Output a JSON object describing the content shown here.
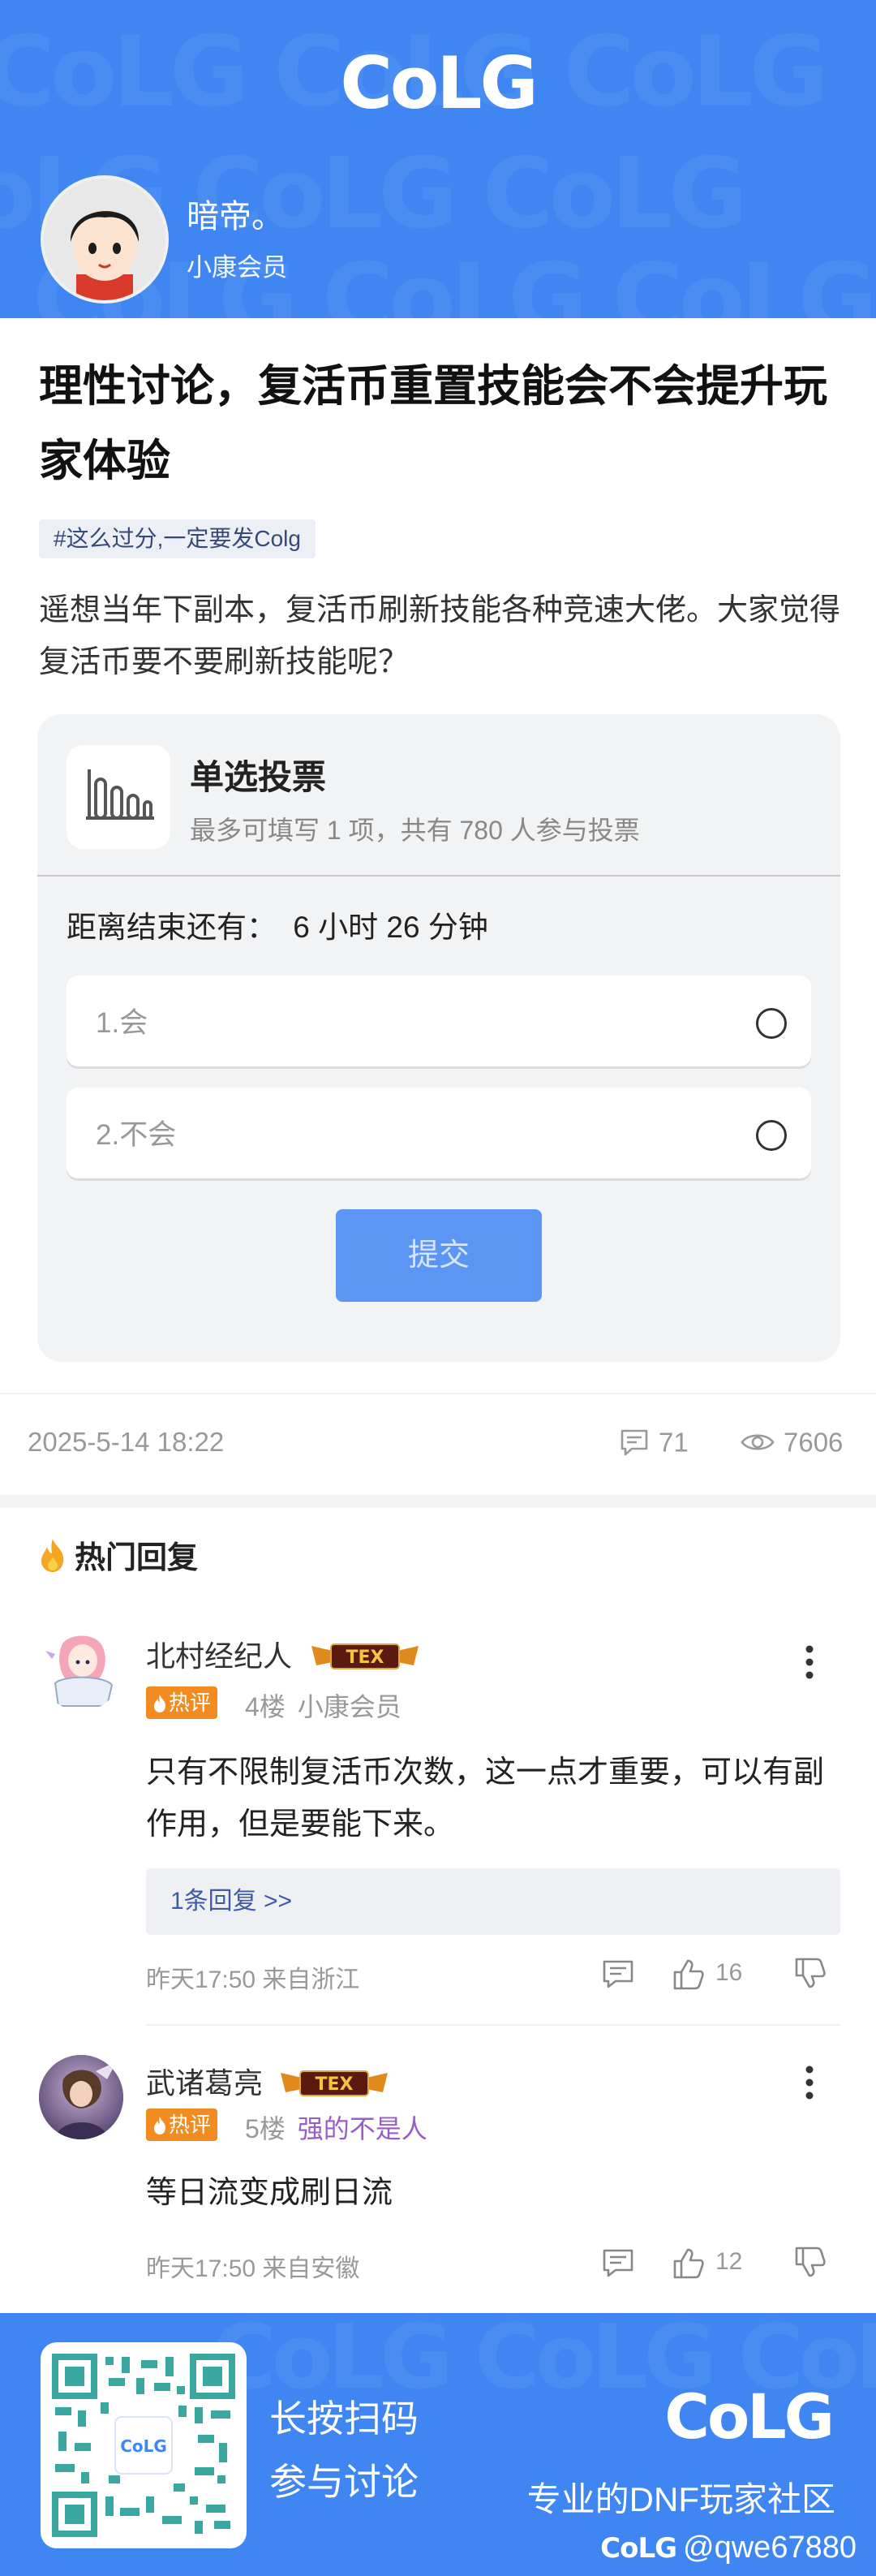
{
  "header": {
    "logo_text": "CoLG",
    "author_name": "暗帝。",
    "author_level": "小康会员"
  },
  "post": {
    "title": "理性讨论，复活币重置技能会不会提升玩家体验",
    "tag": "#这么过分,一定要发Colg",
    "body": "遥想当年下副本，复活币刷新技能各种竞速大佬。大家觉得复活币要不要刷新技能呢？"
  },
  "poll": {
    "title": "单选投票",
    "subtitle": "最多可填写 1 项，共有 780 人参与投票",
    "timer_label": "距离结束还有：",
    "timer_value": "6 小时 26 分钟",
    "options": [
      {
        "label": "1.会"
      },
      {
        "label": "2.不会"
      }
    ],
    "submit_label": "提交"
  },
  "meta": {
    "date": "2025-5-14 18:22",
    "comment_count": "71",
    "view_count": "7606"
  },
  "hot_section": {
    "title": "热门回复"
  },
  "replies": [
    {
      "name": "北村经纪人",
      "badge_text": "TEX",
      "hot_label": "热评",
      "floor": "4楼",
      "level": "小康会员",
      "content": "只有不限制复活币次数，这一点才重要，可以有副作用，但是要能下来。",
      "sub_reply": "1条回复 >>",
      "time": "昨天17:50 来自浙江",
      "likes": "16"
    },
    {
      "name": "武诸葛亮",
      "badge_text": "TEX",
      "hot_label": "热评",
      "floor": "5楼",
      "level": "强的不是人",
      "content": "等日流变成刷日流",
      "time": "昨天17:50 来自安徽",
      "likes": "12"
    }
  ],
  "footer": {
    "qr_line1": "长按扫码",
    "qr_line2": "参与讨论",
    "logo_text": "CoLG",
    "slogan": "专业的DNF玩家社区",
    "watermark_logo": "CoLG",
    "watermark_user": "@qwe67880"
  },
  "colors": {
    "brand_blue": "#3f86f2",
    "submit_blue": "#5c96f4",
    "hot_orange": "#f28c21",
    "level_purple": "#9a5cc6"
  }
}
